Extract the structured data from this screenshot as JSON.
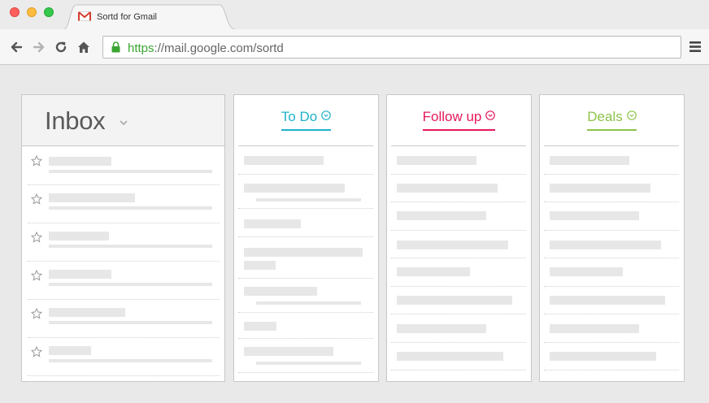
{
  "browser": {
    "tab_title": "Sortd for Gmail",
    "url_scheme": "https",
    "url_rest": "://mail.google.com/sortd",
    "icons": {
      "back": "arrow-left-icon",
      "forward": "arrow-right-icon",
      "reload": "reload-icon",
      "home": "home-icon",
      "lock": "lock-icon",
      "menu": "hamburger-menu-icon",
      "favicon": "gmail-icon"
    }
  },
  "inbox": {
    "title": "Inbox",
    "email_count": 6
  },
  "columns": [
    {
      "id": "todo",
      "title": "To Do",
      "color": "#1fb3c9"
    },
    {
      "id": "followup",
      "title": "Follow up",
      "color": "#e5185a"
    },
    {
      "id": "deals",
      "title": "Deals",
      "color": "#8dc34a"
    }
  ]
}
